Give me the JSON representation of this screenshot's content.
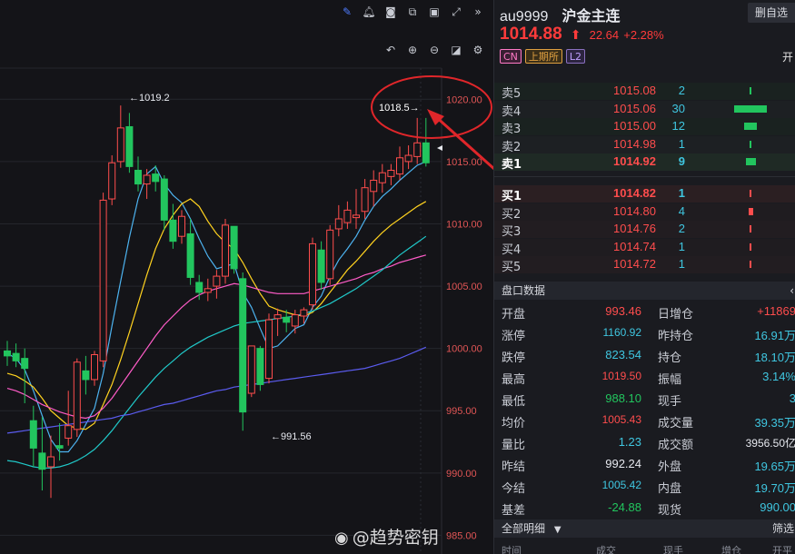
{
  "chart_toolbar": {
    "icons": [
      "pencil-icon",
      "bell-icon",
      "camera-icon",
      "copy-icon",
      "monitor-icon",
      "fullscreen-icon",
      "collapse-right-icon"
    ],
    "secondary_icons": [
      "undo-icon",
      "zoom-in-icon",
      "zoom-out-icon",
      "layout-icon",
      "settings-icon"
    ]
  },
  "chart_data": {
    "type": "candlestick",
    "y_ticks": [
      "1020.00",
      "1015.00",
      "1010.00",
      "1005.00",
      "1000.00",
      "995.00",
      "990.00",
      "985.00"
    ],
    "ylim": [
      983.5,
      1022.5
    ],
    "high_label": "←1019.2",
    "low_label": "←991.56",
    "annotation_label": "1018.5→",
    "up_color": "#ff4d4d",
    "down_color": "#22c55e",
    "candles": [
      {
        "o": 999.8,
        "h": 1000.6,
        "c": 999.4,
        "l": 998.6
      },
      {
        "o": 999.6,
        "h": 1000.4,
        "c": 999.0,
        "l": 998.5
      },
      {
        "o": 999.2,
        "h": 1000.0,
        "c": 998.4,
        "l": 995.6
      },
      {
        "o": 994.2,
        "h": 995.4,
        "c": 992.0,
        "l": 990.5
      },
      {
        "o": 991.6,
        "h": 994.5,
        "c": 990.3,
        "l": 988.6
      },
      {
        "o": 990.5,
        "h": 993.0,
        "c": 991.3,
        "l": 988.0
      },
      {
        "o": 992.2,
        "h": 994.0,
        "c": 992.0,
        "l": 991.0
      },
      {
        "o": 992.8,
        "h": 996.6,
        "c": 993.8,
        "l": 992.2
      },
      {
        "o": 993.5,
        "h": 999.2,
        "c": 998.9,
        "l": 992.9
      },
      {
        "o": 998.2,
        "h": 999.4,
        "c": 997.5,
        "l": 996.3
      },
      {
        "o": 997.5,
        "h": 999.8,
        "c": 999.5,
        "l": 997.0
      },
      {
        "o": 999.0,
        "h": 1012.5,
        "c": 1011.9,
        "l": 998.5
      },
      {
        "o": 1012.0,
        "h": 1015.5,
        "c": 1014.9,
        "l": 1011.5
      },
      {
        "o": 1015.0,
        "h": 1019.5,
        "c": 1017.7,
        "l": 1014.5
      },
      {
        "o": 1017.8,
        "h": 1018.9,
        "c": 1014.6,
        "l": 1014.1
      },
      {
        "o": 1014.3,
        "h": 1015.4,
        "c": 1013.2,
        "l": 1012.6
      },
      {
        "o": 1013.2,
        "h": 1014.4,
        "c": 1013.9,
        "l": 1012.0
      },
      {
        "o": 1014.0,
        "h": 1014.7,
        "c": 1013.4,
        "l": 1012.6
      },
      {
        "o": 1013.6,
        "h": 1013.9,
        "c": 1010.3,
        "l": 1009.5
      },
      {
        "o": 1010.3,
        "h": 1011.6,
        "c": 1008.6,
        "l": 1008.0
      },
      {
        "o": 1009.0,
        "h": 1011.1,
        "c": 1010.6,
        "l": 1008.4
      },
      {
        "o": 1009.2,
        "h": 1010.4,
        "c": 1005.7,
        "l": 1005.1
      },
      {
        "o": 1005.3,
        "h": 1005.9,
        "c": 1004.5,
        "l": 1003.9
      },
      {
        "o": 1004.5,
        "h": 1005.6,
        "c": 1004.8,
        "l": 1003.8
      },
      {
        "o": 1005.0,
        "h": 1006.3,
        "c": 1005.8,
        "l": 1004.0
      },
      {
        "o": 1005.8,
        "h": 1010.4,
        "c": 1009.9,
        "l": 1005.2
      },
      {
        "o": 1009.8,
        "h": 1009.7,
        "c": 1006.4,
        "l": 1006.0
      },
      {
        "o": 1005.6,
        "h": 1006.1,
        "c": 994.9,
        "l": 993.4
      },
      {
        "o": 996.4,
        "h": 999.8,
        "c": 1000.2,
        "l": 996.1
      },
      {
        "o": 1000.0,
        "h": 1000.2,
        "c": 997.1,
        "l": 996.6
      },
      {
        "o": 997.6,
        "h": 1002.8,
        "c": 1002.3,
        "l": 997.2
      },
      {
        "o": 1002.4,
        "h": 1003.2,
        "c": 1002.7,
        "l": 1001.0
      },
      {
        "o": 1002.5,
        "h": 1003.1,
        "c": 1002.1,
        "l": 1001.3
      },
      {
        "o": 1001.8,
        "h": 1003.1,
        "c": 1002.7,
        "l": 1001.2
      },
      {
        "o": 1002.6,
        "h": 1003.3,
        "c": 1003.1,
        "l": 1002.0
      },
      {
        "o": 1003.5,
        "h": 1008.9,
        "c": 1008.4,
        "l": 1003.1
      },
      {
        "o": 1007.9,
        "h": 1008.6,
        "c": 1005.3,
        "l": 1004.7
      },
      {
        "o": 1005.6,
        "h": 1009.9,
        "c": 1009.5,
        "l": 1005.1
      },
      {
        "o": 1009.6,
        "h": 1011.5,
        "c": 1010.4,
        "l": 1009.0
      },
      {
        "o": 1010.1,
        "h": 1011.8,
        "c": 1011.1,
        "l": 1009.6
      },
      {
        "o": 1010.5,
        "h": 1012.8,
        "c": 1010.7,
        "l": 1009.6
      },
      {
        "o": 1011.0,
        "h": 1013.6,
        "c": 1012.9,
        "l": 1010.4
      },
      {
        "o": 1012.6,
        "h": 1014.3,
        "c": 1013.5,
        "l": 1011.4
      },
      {
        "o": 1013.3,
        "h": 1014.8,
        "c": 1014.1,
        "l": 1012.5
      },
      {
        "o": 1013.8,
        "h": 1014.8,
        "c": 1014.3,
        "l": 1013.1
      },
      {
        "o": 1014.0,
        "h": 1016.2,
        "c": 1015.3,
        "l": 1013.5
      },
      {
        "o": 1015.0,
        "h": 1016.3,
        "c": 1015.5,
        "l": 1014.4
      },
      {
        "o": 1015.4,
        "h": 1018.5,
        "c": 1016.5,
        "l": 1014.8
      },
      {
        "o": 1016.5,
        "h": 1018.5,
        "c": 1014.9,
        "l": 1014.6
      }
    ],
    "ma_lines": [
      {
        "color": "#4db3f0",
        "values": [
          999.6,
          999.2,
          998.3,
          996.6,
          994.6,
          992.7,
          991.7,
          991.7,
          992.6,
          993.9,
          995.2,
          998.0,
          1001.8,
          1005.4,
          1008.9,
          1012.0,
          1014.0,
          1014.6,
          1013.2,
          1012.3,
          1011.7,
          1010.4,
          1008.8,
          1007.4,
          1006.4,
          1006.6,
          1006.8,
          1004.5,
          1003.3,
          1001.6,
          1000.0,
          1000.2,
          1000.9,
          1001.6,
          1001.9,
          1003.3,
          1004.2,
          1005.8,
          1007.1,
          1008.0,
          1009.0,
          1010.3,
          1011.4,
          1012.2,
          1012.8,
          1013.5,
          1014.1,
          1014.7,
          1015.0
        ]
      },
      {
        "color": "#ffd21f",
        "values": [
          998.0,
          997.8,
          997.4,
          996.9,
          996.0,
          995.0,
          994.4,
          993.8,
          993.6,
          993.5,
          994.0,
          995.5,
          997.1,
          999.1,
          1001.3,
          1003.6,
          1005.9,
          1008.0,
          1009.6,
          1010.7,
          1011.6,
          1012.0,
          1011.4,
          1010.2,
          1009.2,
          1008.5,
          1008.0,
          1006.9,
          1005.6,
          1004.4,
          1003.4,
          1003.1,
          1002.9,
          1002.7,
          1002.6,
          1002.9,
          1003.6,
          1004.5,
          1005.4,
          1006.3,
          1007.0,
          1007.8,
          1008.6,
          1009.3,
          1009.9,
          1010.4,
          1010.9,
          1011.4,
          1011.8
        ]
      },
      {
        "color": "#ff5cc8",
        "values": [
          996.8,
          996.6,
          996.3,
          995.9,
          995.5,
          995.2,
          994.9,
          994.7,
          994.5,
          994.4,
          994.6,
          995.2,
          996.0,
          997.0,
          998.0,
          999.0,
          1000.0,
          1001.0,
          1001.9,
          1002.6,
          1003.3,
          1003.9,
          1004.3,
          1004.6,
          1004.8,
          1005.0,
          1005.2,
          1005.1,
          1004.9,
          1004.7,
          1004.5,
          1004.4,
          1004.4,
          1004.4,
          1004.4,
          1004.6,
          1004.8,
          1005.0,
          1005.2,
          1005.4,
          1005.6,
          1005.9,
          1006.1,
          1006.4,
          1006.6,
          1006.9,
          1007.1,
          1007.3,
          1007.5
        ]
      },
      {
        "color": "#20c8c8",
        "values": [
          991.0,
          990.9,
          990.7,
          990.5,
          990.4,
          990.4,
          990.5,
          990.7,
          991.0,
          991.4,
          991.9,
          992.6,
          993.4,
          994.3,
          995.2,
          996.1,
          996.9,
          997.7,
          998.4,
          999.0,
          999.6,
          1000.1,
          1000.5,
          1000.9,
          1001.2,
          1001.5,
          1001.8,
          1002.0,
          1002.1,
          1002.2,
          1002.3,
          1002.4,
          1002.5,
          1002.6,
          1002.8,
          1003.0,
          1003.3,
          1003.6,
          1004.0,
          1004.4,
          1004.8,
          1005.3,
          1005.8,
          1006.3,
          1006.9,
          1007.5,
          1008.0,
          1008.5,
          1009.0
        ]
      },
      {
        "color": "#5b5cf0",
        "values": [
          993.2,
          993.3,
          993.4,
          993.5,
          993.6,
          993.7,
          993.8,
          993.9,
          994.0,
          994.1,
          994.2,
          994.3,
          994.4,
          994.6,
          994.7,
          994.9,
          995.1,
          995.3,
          995.5,
          995.6,
          995.8,
          996.0,
          996.2,
          996.4,
          996.6,
          996.7,
          996.9,
          997.0,
          997.1,
          997.2,
          997.3,
          997.4,
          997.5,
          997.6,
          997.7,
          997.8,
          997.9,
          998.0,
          998.1,
          998.2,
          998.3,
          998.4,
          998.6,
          998.8,
          999.0,
          999.2,
          999.5,
          999.8,
          1000.1
        ]
      }
    ]
  },
  "quote": {
    "symbol": "au9999",
    "name": "沪金主连",
    "watch_button": "删自选",
    "last": "1014.88",
    "change": "22.64",
    "change_pct": "+2.28%",
    "tags": [
      "CN",
      "上期所",
      "L2"
    ],
    "open_status": "开"
  },
  "order_book": {
    "asks": [
      {
        "label": "卖5",
        "price": "1015.08",
        "vol": "2",
        "bar": 2
      },
      {
        "label": "卖4",
        "price": "1015.06",
        "vol": "30",
        "bar": 30
      },
      {
        "label": "卖3",
        "price": "1015.00",
        "vol": "12",
        "bar": 12
      },
      {
        "label": "卖2",
        "price": "1014.98",
        "vol": "1",
        "bar": 1
      },
      {
        "label": "卖1",
        "price": "1014.92",
        "vol": "9",
        "bar": 9
      }
    ],
    "bids": [
      {
        "label": "买1",
        "price": "1014.82",
        "vol": "1",
        "bar": 1
      },
      {
        "label": "买2",
        "price": "1014.80",
        "vol": "4",
        "bar": 4
      },
      {
        "label": "买3",
        "price": "1014.76",
        "vol": "2",
        "bar": 2
      },
      {
        "label": "买4",
        "price": "1014.74",
        "vol": "1",
        "bar": 1
      },
      {
        "label": "买5",
        "price": "1014.72",
        "vol": "1",
        "bar": 1
      }
    ]
  },
  "market_data": {
    "title": "盘口数据",
    "rows": [
      {
        "k1": "开盘",
        "v1": "993.46",
        "c1": "red",
        "k2": "日增仓",
        "v2": "+11869",
        "c2": "red"
      },
      {
        "k1": "涨停",
        "v1": "1160.92",
        "c1": "cyan-small",
        "k2": "昨持仓",
        "v2": "16.91万",
        "c2": "cyan"
      },
      {
        "k1": "跌停",
        "v1": "823.54",
        "c1": "cyan",
        "k2": "持仓",
        "v2": "18.10万",
        "c2": "cyan"
      },
      {
        "k1": "最高",
        "v1": "1019.50",
        "c1": "red-small",
        "k2": "振幅",
        "v2": "3.14%",
        "c2": "cyan"
      },
      {
        "k1": "最低",
        "v1": "988.10",
        "c1": "green",
        "k2": "现手",
        "v2": "3",
        "c2": "cyan"
      },
      {
        "k1": "均价",
        "v1": "1005.43",
        "c1": "red-small",
        "k2": "成交量",
        "v2": "39.35万",
        "c2": "cyan"
      },
      {
        "k1": "量比",
        "v1": "1.23",
        "c1": "cyan",
        "k2": "成交额",
        "v2": "3956.50亿",
        "c2": "white-small"
      },
      {
        "k1": "昨结",
        "v1": "992.24",
        "c1": "white",
        "k2": "外盘",
        "v2": "19.65万",
        "c2": "cyan"
      },
      {
        "k1": "今结",
        "v1": "1005.42",
        "c1": "cyan-small",
        "k2": "内盘",
        "v2": "19.70万",
        "c2": "cyan"
      },
      {
        "k1": "基差",
        "v1": "-24.88",
        "c1": "green",
        "k2": "现货",
        "v2": "990.00",
        "c2": "cyan"
      }
    ]
  },
  "trades": {
    "title": "全部明细",
    "filter_button": "筛选",
    "columns": [
      "时间",
      "成交",
      "现手",
      "增仓",
      "开平"
    ]
  },
  "watermark": {
    "text": "@趋势密钥"
  }
}
